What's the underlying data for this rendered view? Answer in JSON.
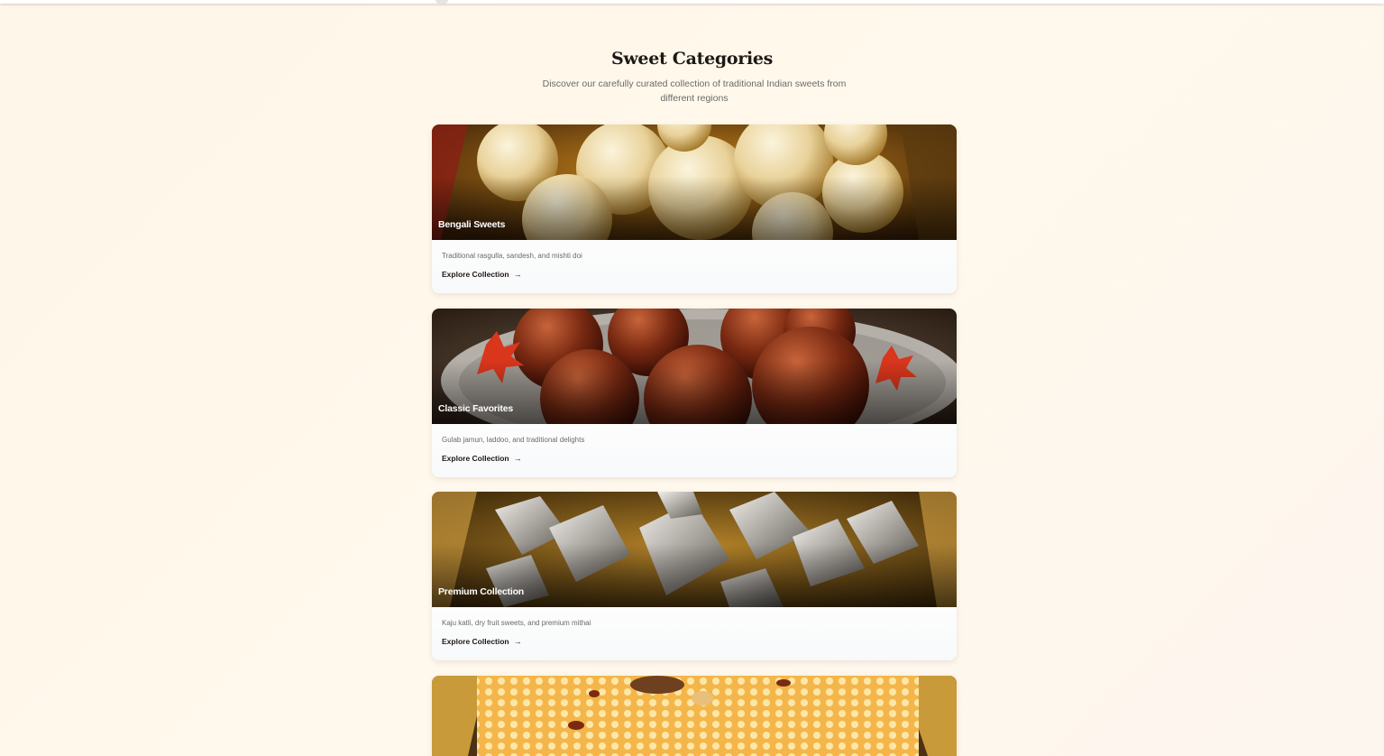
{
  "page": {
    "title": "Sweet Categories",
    "subtitle": "Discover our carefully curated collection of traditional Indian sweets from different regions"
  },
  "categories": [
    {
      "name": "Bengali Sweets",
      "description": "Traditional rasgulla, sandesh, and mishti doi",
      "link_label": "Explore Collection",
      "link_icon": "arrow-right-icon"
    },
    {
      "name": "Classic Favorites",
      "description": "Gulab jamun, laddoo, and traditional delights",
      "link_label": "Explore Collection",
      "link_icon": "arrow-right-icon"
    },
    {
      "name": "Premium Collection",
      "description": "Kaju katli, dry fruit sweets, and premium mithai",
      "link_label": "Explore Collection",
      "link_icon": "arrow-right-icon"
    }
  ],
  "colors": {
    "background": "#fef6e8",
    "title": "#1c1917",
    "muted_text": "#6b6b6b",
    "card_overlay_text": "#ffffff"
  }
}
